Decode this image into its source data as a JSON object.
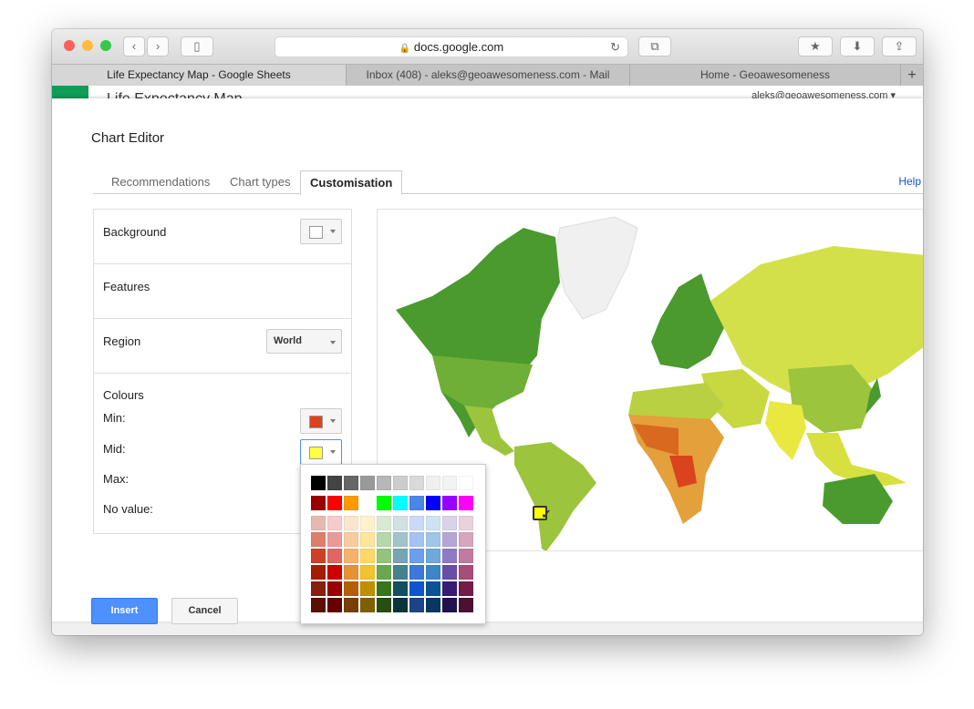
{
  "browser": {
    "url": "docs.google.com",
    "tabs": [
      {
        "label": "Life Expectancy Map - Google Sheets",
        "active": true
      },
      {
        "label": "Inbox (408) - aleks@geoawesomeness.com - Mail",
        "active": false
      },
      {
        "label": "Home - Geoawesomeness",
        "active": false
      }
    ],
    "new_tab": "+"
  },
  "sheet": {
    "account": "aleks@geoawesomeness.com ▾",
    "title": "Life Expectancy Map"
  },
  "editor": {
    "title": "Chart Editor",
    "tabs": [
      "Recommendations",
      "Chart types",
      "Customisation"
    ],
    "active_tab": "Customisation",
    "help": "Help",
    "background": {
      "label": "Background",
      "color": "#ffffff"
    },
    "features": {
      "label": "Features"
    },
    "region": {
      "label": "Region",
      "value": "World"
    },
    "colours": {
      "label": "Colours",
      "min_label": "Min:",
      "min_color": "#d9441f",
      "mid_label": "Mid:",
      "mid_color": "#ffff44",
      "max_label": "Max:",
      "novalue_label": "No value:"
    },
    "insert": "Insert",
    "cancel": "Cancel"
  },
  "palette": {
    "selected": "#ffff44",
    "check": "✓",
    "rows": [
      [
        "#000000",
        "#434343",
        "#666666",
        "#999999",
        "#b7b7b7",
        "#cccccc",
        "#d9d9d9",
        "#efefef",
        "#f3f3f3",
        "#ffffff"
      ],
      [
        "#980000",
        "#ff0000",
        "#ff9900",
        "#ffff00",
        "#00ff00",
        "#00ffff",
        "#4a86e8",
        "#0000ff",
        "#9900ff",
        "#ff00ff"
      ],
      [
        "#e6b8af",
        "#f4cccc",
        "#fce5cd",
        "#fff2cc",
        "#d9ead3",
        "#d0e0e3",
        "#c9daf8",
        "#cfe2f3",
        "#d9d2e9",
        "#ead1dc"
      ],
      [
        "#dd7e6b",
        "#ea9999",
        "#f9cb9c",
        "#ffe599",
        "#b6d7a8",
        "#a2c4c9",
        "#a4c2f4",
        "#9fc5e8",
        "#b4a7d6",
        "#d5a6bd"
      ],
      [
        "#cc4125",
        "#e06666",
        "#f6b26b",
        "#ffd966",
        "#93c47d",
        "#76a5af",
        "#6d9eeb",
        "#6fa8dc",
        "#8e7cc3",
        "#c27ba0"
      ],
      [
        "#a61c00",
        "#cc0000",
        "#e69138",
        "#f1c232",
        "#6aa84f",
        "#45818e",
        "#3c78d8",
        "#3d85c6",
        "#674ea7",
        "#a64d79"
      ],
      [
        "#85200c",
        "#990000",
        "#b45f06",
        "#bf9000",
        "#38761d",
        "#134f5c",
        "#1155cc",
        "#0b5394",
        "#351c75",
        "#741b47"
      ],
      [
        "#5b0f00",
        "#660000",
        "#783f04",
        "#7f6000",
        "#274e13",
        "#0c343d",
        "#1c4587",
        "#073763",
        "#20124d",
        "#4c1130"
      ]
    ]
  },
  "colors": {
    "insert_blue": "#4d90fe",
    "sheets_green": "#0f9d58",
    "map_high": "#4a9a2e",
    "map_mid": "#e8e840",
    "map_low": "#d9441f",
    "map_nodata": "#f0f0f0"
  }
}
